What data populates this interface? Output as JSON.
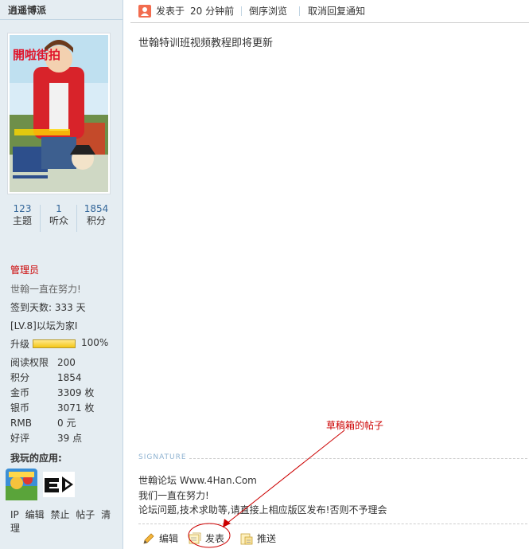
{
  "user": {
    "name": "逍遥博派",
    "avatar_caption": "開啦街拍",
    "stats": [
      {
        "value": "123",
        "label": "主题"
      },
      {
        "value": "1",
        "label": "听众"
      },
      {
        "value": "1854",
        "label": "积分"
      }
    ],
    "group": "管理员",
    "motto": "世翰一直在努力!",
    "sign_days": "签到天数: 333 天",
    "level": "[LV.8]以坛为家I",
    "upgrade_label": "升级",
    "upgrade_percent": "100%",
    "upgrade_fraction": 1.0,
    "info": [
      {
        "key": "阅读权限",
        "value": "200"
      },
      {
        "key": "积分",
        "value": "1854"
      },
      {
        "key": "金币",
        "value": "3309 枚"
      },
      {
        "key": "银币",
        "value": "3071 枚"
      },
      {
        "key": "RMB",
        "value": "0 元"
      },
      {
        "key": "好评",
        "value": "39 点"
      }
    ],
    "apps_label": "我玩的应用:",
    "admin_links": [
      "IP",
      "编辑",
      "禁止",
      "帖子",
      "清理"
    ]
  },
  "post": {
    "posted_label": "发表于",
    "posted_time": "20 分钟前",
    "reverse_view": "倒序浏览",
    "cancel_notify": "取消回复通知",
    "body": "世翰特训班视频教程即将更新",
    "signature_label": "SIGNATURE",
    "signature_lines": [
      "世翰论坛  Www.4Han.Com",
      "我们一直在努力!",
      "论坛问题,技术求助等,请直接上相应版区发布!否则不予理会"
    ],
    "actions": [
      "编辑",
      "发表",
      "推送"
    ]
  },
  "annotation": {
    "text": "草稿箱的帖子",
    "color": "#cc0000"
  },
  "colors": {
    "sidebar_bg": "#e5edf2",
    "link_blue": "#336699",
    "admin_red": "#cc0000"
  }
}
